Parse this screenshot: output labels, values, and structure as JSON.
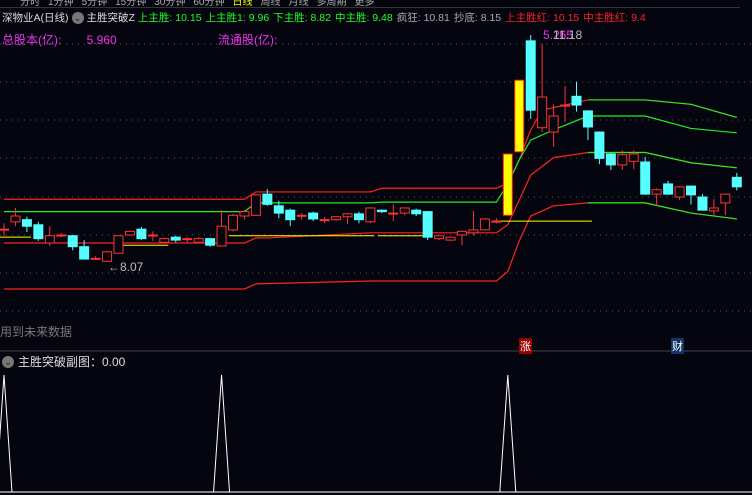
{
  "tabs": [
    "分时",
    "1分钟",
    "5分钟",
    "15分钟",
    "30分钟",
    "60分钟",
    "日线",
    "周线",
    "月线",
    "多周期",
    "更多"
  ],
  "active_tab": "日线",
  "header": {
    "stock": "深物业A(日线)",
    "indicator": "主胜突破Z",
    "values": [
      {
        "label": "上主胜: 10.15",
        "color": "g"
      },
      {
        "label": "上主胜1: 9.96",
        "color": "g"
      },
      {
        "label": "下主胜: 8.82",
        "color": "g"
      },
      {
        "label": "中主胜: 9.48",
        "color": "g"
      },
      {
        "label": "疯狂: 10.81",
        "color": "gr"
      },
      {
        "label": "抄底: 8.15",
        "color": "gr"
      },
      {
        "label": "上主胜红: 10.15",
        "color": "r"
      },
      {
        "label": "中主胜红: 9.4",
        "color": "r"
      }
    ]
  },
  "info": {
    "total_label": "总股本(亿):",
    "total_value": "5.960",
    "float_label": "流通股(亿):"
  },
  "annotations": {
    "high": "11.18",
    "high_overlap": "5.265",
    "low": "←8.07",
    "future_note": "用到未来数据",
    "tag_zhang": "涨",
    "tag_cai": "财"
  },
  "sub": {
    "title": "主胜突破副图：0.00"
  },
  "colors": {
    "up": "#ff3333",
    "down": "#55ffff",
    "band_green": "#22ee22",
    "band_red": "#ff2222",
    "limit_fill": "#ffff00",
    "yellow_line": "#ffff00"
  },
  "chart_data": {
    "type": "candlestick",
    "ylim": [
      7.6,
      11.3
    ],
    "candles": [
      [
        8.52,
        8.6,
        8.43,
        8.52
      ],
      [
        8.62,
        8.81,
        8.56,
        8.7
      ],
      [
        8.65,
        8.69,
        8.48,
        8.56
      ],
      [
        8.58,
        8.62,
        8.36,
        8.39
      ],
      [
        8.33,
        8.56,
        8.29,
        8.43
      ],
      [
        8.44,
        8.47,
        8.41,
        8.44
      ],
      [
        8.43,
        8.44,
        8.23,
        8.28
      ],
      [
        8.28,
        8.37,
        8.11,
        8.11
      ],
      [
        8.12,
        8.15,
        8.1,
        8.12
      ],
      [
        8.08,
        8.22,
        8.07,
        8.21
      ],
      [
        8.19,
        8.44,
        8.19,
        8.43
      ],
      [
        8.44,
        8.5,
        8.43,
        8.49
      ],
      [
        8.52,
        8.55,
        8.37,
        8.39
      ],
      [
        8.44,
        8.49,
        8.36,
        8.44
      ],
      [
        8.34,
        8.4,
        8.33,
        8.39
      ],
      [
        8.41,
        8.43,
        8.34,
        8.37
      ],
      [
        8.39,
        8.41,
        8.34,
        8.39
      ],
      [
        8.34,
        8.41,
        8.33,
        8.39
      ],
      [
        8.39,
        8.4,
        8.28,
        8.3
      ],
      [
        8.29,
        8.78,
        8.28,
        8.56
      ],
      [
        8.51,
        8.73,
        8.49,
        8.71
      ],
      [
        8.7,
        8.78,
        8.65,
        8.76
      ],
      [
        8.71,
        9.0,
        8.7,
        8.99
      ],
      [
        9.0,
        9.07,
        8.84,
        8.86
      ],
      [
        8.84,
        8.91,
        8.67,
        8.74
      ],
      [
        8.78,
        8.8,
        8.56,
        8.65
      ],
      [
        8.71,
        8.74,
        8.65,
        8.71
      ],
      [
        8.74,
        8.76,
        8.63,
        8.66
      ],
      [
        8.65,
        8.69,
        8.6,
        8.65
      ],
      [
        8.65,
        8.7,
        8.63,
        8.69
      ],
      [
        8.69,
        8.74,
        8.59,
        8.73
      ],
      [
        8.73,
        8.76,
        8.6,
        8.65
      ],
      [
        8.62,
        8.82,
        8.6,
        8.81
      ],
      [
        8.78,
        8.79,
        8.74,
        8.76
      ],
      [
        8.74,
        8.86,
        8.63,
        8.74
      ],
      [
        8.74,
        8.82,
        8.71,
        8.81
      ],
      [
        8.78,
        8.8,
        8.7,
        8.73
      ],
      [
        8.76,
        8.77,
        8.37,
        8.41
      ],
      [
        8.39,
        8.44,
        8.37,
        8.43
      ],
      [
        8.37,
        8.42,
        8.36,
        8.41
      ],
      [
        8.44,
        8.5,
        8.3,
        8.49
      ],
      [
        8.47,
        8.77,
        8.43,
        8.51
      ],
      [
        8.51,
        8.67,
        8.5,
        8.66
      ],
      [
        8.63,
        8.67,
        8.6,
        8.63
      ],
      [
        8.71,
        9.55,
        8.7,
        9.55
      ],
      [
        9.58,
        10.56,
        9.58,
        10.56
      ],
      [
        11.1,
        11.18,
        10.03,
        10.15
      ],
      [
        9.91,
        11.06,
        9.85,
        10.33
      ],
      [
        9.85,
        10.23,
        9.65,
        10.07
      ],
      [
        10.22,
        10.48,
        9.99,
        10.22
      ],
      [
        10.34,
        10.54,
        10.13,
        10.22
      ],
      [
        10.14,
        10.15,
        9.74,
        9.92
      ],
      [
        9.85,
        9.86,
        9.41,
        9.49
      ],
      [
        9.55,
        9.56,
        9.33,
        9.4
      ],
      [
        9.4,
        9.6,
        9.33,
        9.54
      ],
      [
        9.45,
        9.6,
        9.34,
        9.55
      ],
      [
        9.44,
        9.51,
        8.99,
        9.0
      ],
      [
        9.0,
        9.08,
        8.84,
        9.06
      ],
      [
        9.14,
        9.18,
        8.99,
        9.0
      ],
      [
        8.96,
        9.11,
        8.92,
        9.1
      ],
      [
        9.11,
        9.12,
        8.86,
        8.99
      ],
      [
        8.96,
        9.0,
        8.78,
        8.78
      ],
      [
        8.77,
        8.93,
        8.71,
        8.81
      ],
      [
        8.88,
        9.01,
        8.71,
        9.0
      ],
      [
        9.23,
        9.29,
        9.05,
        9.1
      ]
    ],
    "limit_up_candles": [
      45,
      46
    ],
    "bands": [
      {
        "color": "red",
        "points": [
          [
            1,
            8.93
          ],
          [
            22,
            8.93
          ],
          [
            23,
            9.03
          ],
          [
            33,
            9.03
          ],
          [
            34,
            9.08
          ],
          [
            44,
            9.08
          ],
          [
            45,
            9.15
          ],
          [
            46,
            9.47
          ],
          [
            47,
            9.88
          ],
          [
            48,
            10.15
          ],
          [
            52,
            10.29
          ],
          [
            57,
            10.29
          ],
          [
            61,
            10.23
          ],
          [
            65,
            10.05
          ]
        ]
      },
      {
        "color": "green",
        "points": [
          [
            1,
            8.76
          ],
          [
            22,
            8.76
          ],
          [
            23,
            8.88
          ],
          [
            33,
            8.88
          ],
          [
            34,
            8.89
          ],
          [
            44,
            8.89
          ],
          [
            45,
            9.14
          ],
          [
            46,
            9.47
          ],
          [
            47,
            9.74
          ],
          [
            49,
            9.88
          ],
          [
            52,
            10.07
          ],
          [
            57,
            10.07
          ],
          [
            61,
            9.9
          ],
          [
            65,
            9.84
          ]
        ]
      },
      {
        "color": "red",
        "points": [
          [
            1,
            8.33
          ],
          [
            22,
            8.33
          ],
          [
            23,
            8.4
          ],
          [
            24,
            8.4
          ],
          [
            33,
            8.47
          ],
          [
            44,
            8.47
          ],
          [
            45,
            8.58
          ],
          [
            46,
            8.92
          ],
          [
            47,
            9.26
          ],
          [
            49,
            9.5
          ],
          [
            52,
            9.57
          ],
          [
            57,
            9.57
          ],
          [
            61,
            9.43
          ],
          [
            65,
            9.36
          ]
        ]
      },
      {
        "color": "red",
        "points": [
          [
            1,
            7.7
          ],
          [
            22,
            7.7
          ],
          [
            23,
            7.77
          ],
          [
            33,
            7.81
          ],
          [
            44,
            7.81
          ],
          [
            45,
            7.94
          ],
          [
            46,
            8.36
          ],
          [
            47,
            8.7
          ],
          [
            49,
            8.84
          ],
          [
            52,
            8.88
          ],
          [
            57,
            8.88
          ],
          [
            61,
            8.74
          ],
          [
            65,
            8.66
          ]
        ]
      },
      {
        "color": "green",
        "points": [
          [
            52,
            9.57
          ],
          [
            57,
            9.57
          ],
          [
            61,
            9.43
          ],
          [
            65,
            9.36
          ]
        ]
      },
      {
        "color": "green",
        "points": [
          [
            52,
            8.88
          ],
          [
            57,
            8.88
          ],
          [
            61,
            8.74
          ],
          [
            65,
            8.66
          ]
        ]
      },
      {
        "color": "green",
        "points": [
          [
            52,
            10.29
          ],
          [
            57,
            10.29
          ],
          [
            61,
            10.23
          ],
          [
            65,
            10.05
          ]
        ]
      }
    ],
    "yellow_lines": [
      [
        1,
        3,
        8.41
      ],
      [
        11,
        15,
        8.3
      ],
      [
        21,
        33,
        8.43
      ],
      [
        34,
        38,
        8.43
      ],
      [
        44,
        52,
        8.63
      ]
    ],
    "sub_signal": {
      "spikes_at": [
        1,
        20,
        45
      ],
      "value": 1,
      "ylim": [
        0,
        1
      ]
    }
  }
}
